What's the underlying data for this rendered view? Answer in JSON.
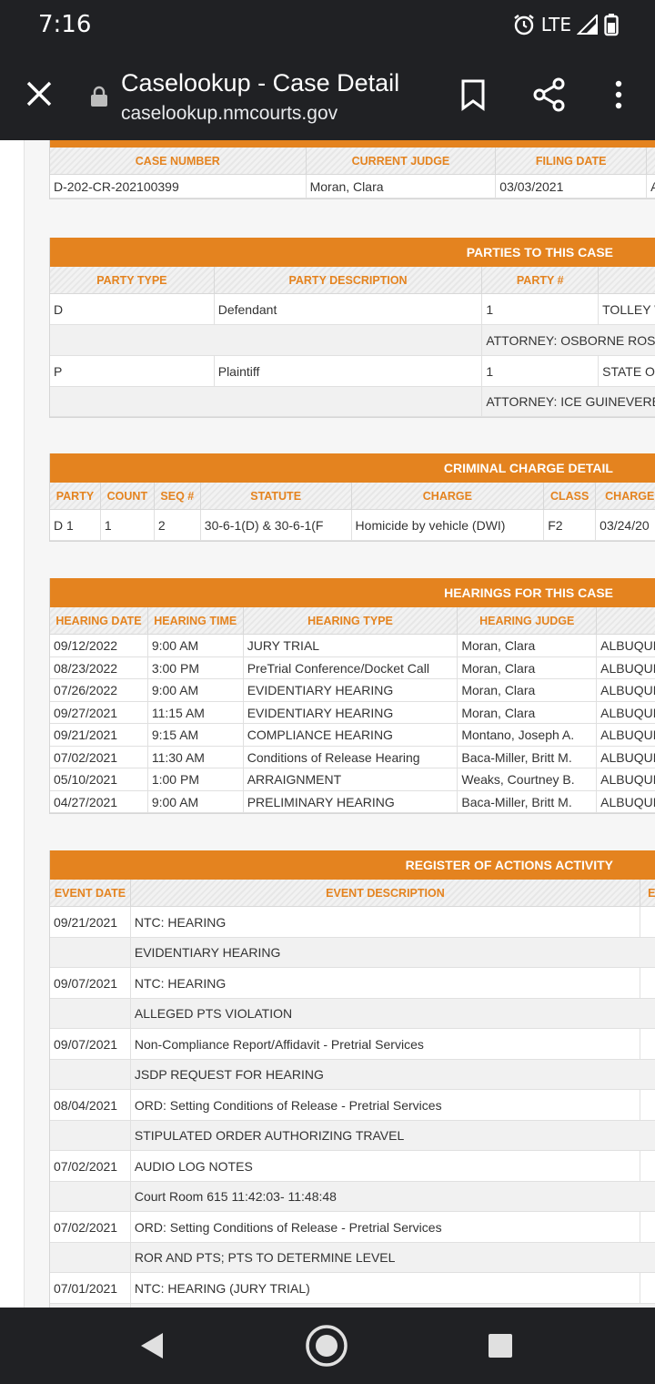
{
  "status": {
    "time": "7:16",
    "network": "LTE"
  },
  "browser": {
    "title": "Caselookup - Case Detail",
    "url": "caselookup.nmcourts.gov"
  },
  "case": {
    "headers": [
      "CASE NUMBER",
      "CURRENT JUDGE",
      "FILING DATE"
    ],
    "row": [
      "D-202-CR-202100399",
      "Moran, Clara",
      "03/03/2021",
      "A"
    ]
  },
  "parties": {
    "title": "PARTIES TO THIS CASE",
    "headers": [
      "PARTY TYPE",
      "PARTY DESCRIPTION",
      "PARTY #",
      ""
    ],
    "rows": [
      {
        "cells": [
          "D",
          "Defendant",
          "1",
          "TOLLEY W"
        ],
        "attorney": "ATTORNEY: OSBORNE ROSE"
      },
      {
        "cells": [
          "P",
          "Plaintiff",
          "1",
          "STATE OF"
        ],
        "attorney": "ATTORNEY: ICE GUINEVERE"
      }
    ]
  },
  "charges": {
    "title": "CRIMINAL CHARGE DETAIL",
    "headers": [
      "PARTY",
      "COUNT",
      "SEQ #",
      "STATUTE",
      "CHARGE",
      "CLASS",
      "CHARGE"
    ],
    "rows": [
      [
        "D 1",
        "1",
        "2",
        "30-6-1(D) & 30-6-1(F",
        "Homicide by vehicle (DWI)",
        "F2",
        "03/24/20"
      ]
    ]
  },
  "hearings": {
    "title": "HEARINGS FOR THIS CASE",
    "headers": [
      "HEARING DATE",
      "HEARING TIME",
      "HEARING TYPE",
      "HEARING JUDGE",
      ""
    ],
    "rows": [
      [
        "09/12/2022",
        "9:00 AM",
        "JURY TRIAL",
        "Moran, Clara",
        "ALBUQUE"
      ],
      [
        "08/23/2022",
        "3:00 PM",
        "PreTrial Conference/Docket Call",
        "Moran, Clara",
        "ALBUQUE"
      ],
      [
        "07/26/2022",
        "9:00 AM",
        "EVIDENTIARY HEARING",
        "Moran, Clara",
        "ALBUQUE"
      ],
      [
        "09/27/2021",
        "11:15 AM",
        "EVIDENTIARY HEARING",
        "Moran, Clara",
        "ALBUQUE"
      ],
      [
        "09/21/2021",
        "9:15 AM",
        "COMPLIANCE HEARING",
        "Montano, Joseph A.",
        "ALBUQUE"
      ],
      [
        "07/02/2021",
        "11:30 AM",
        "Conditions of Release Hearing",
        "Baca-Miller, Britt M.",
        "ALBUQUE"
      ],
      [
        "05/10/2021",
        "1:00 PM",
        "ARRAIGNMENT",
        "Weaks, Courtney B.",
        "ALBUQUE"
      ],
      [
        "04/27/2021",
        "9:00 AM",
        "PRELIMINARY HEARING",
        "Baca-Miller, Britt M.",
        "ALBUQUE"
      ]
    ]
  },
  "register": {
    "title": "REGISTER OF ACTIONS ACTIVITY",
    "headers": [
      "EVENT DATE",
      "EVENT DESCRIPTION",
      "E"
    ],
    "rows": [
      {
        "date": "09/21/2021",
        "desc": "NTC: HEARING",
        "detail": "EVIDENTIARY HEARING"
      },
      {
        "date": "09/07/2021",
        "desc": "NTC: HEARING",
        "detail": "ALLEGED PTS VIOLATION"
      },
      {
        "date": "09/07/2021",
        "desc": "Non-Compliance Report/Affidavit - Pretrial Services",
        "detail": "JSDP REQUEST FOR HEARING"
      },
      {
        "date": "08/04/2021",
        "desc": "ORD: Setting Conditions of Release - Pretrial Services",
        "detail": "STIPULATED ORDER AUTHORIZING TRAVEL"
      },
      {
        "date": "07/02/2021",
        "desc": "AUDIO LOG NOTES",
        "detail": "Court Room 615 11:42:03- 11:48:48"
      },
      {
        "date": "07/02/2021",
        "desc": "ORD: Setting Conditions of Release - Pretrial Services",
        "detail": "ROR AND PTS; PTS TO DETERMINE LEVEL"
      },
      {
        "date": "07/01/2021",
        "desc": "NTC: HEARING (JURY TRIAL)",
        "detail": ""
      }
    ]
  }
}
